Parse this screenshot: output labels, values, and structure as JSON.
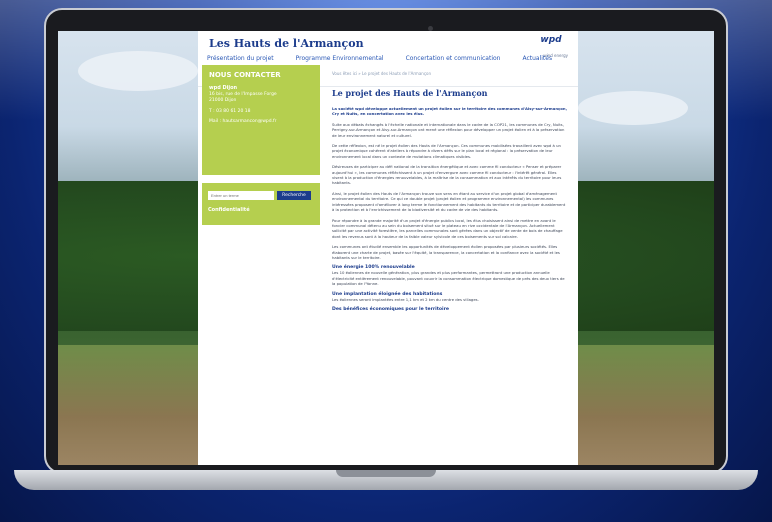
{
  "site": {
    "title": "Les Hauts de l'Armançon",
    "logo": "wpd",
    "logo_sub": "wind energy",
    "nav": [
      "Présentation du projet",
      "Programme Environnemental",
      "Concertation et communication",
      "Actualités"
    ]
  },
  "sidebar": {
    "contact_title": "NOUS CONTACTER",
    "contact_org": "wpd Dijon",
    "contact_address_1": "16 bis, rue de l'Impasse Forge",
    "contact_address_2": "21000 Dijon",
    "contact_phone": "T : 03 80 61 20 18",
    "contact_email": "Mail : hautsarmancon@wpd.fr",
    "search_placeholder": "Entrer un terme",
    "search_button": "Recherche",
    "confidentiality": "Confidentialité"
  },
  "main": {
    "breadcrumb": "Vous êtes ici » Le projet des Hauts de l'Armançon",
    "title": "Le projet des Hauts de l'Armançon",
    "intro": "La société wpd développe actuellement un projet éolien sur le territoire des communes d'Aisy-sur-Armançon, Cry et Nuits, en concertation avec les élus.",
    "paragraphs": [
      "Suite aux débats échangés à l'échelle nationale et internationale dans le cadre de la COP21, les communes de Cry, Nuits, Perrigny-sur-Armançon et Aisy-sur-Armançon ont mené une réflexion pour développer un projet éolien et à la préservation de leur environnement naturel et culturel.",
      "De cette réflexion, est né le projet éolien des Hauts de l'Armançon. Ces communes mobilisées travaillent avec wpd à un projet économique cohérent d'ateliers à répondre à divers défis sur le plan local et régional : la préservation de leur environnement local dans un contexte de mutations climatiques visibles.",
      "Désireuses de participer au défi national de la transition énergétique et avec comme fil conducteur « Penser et préparer aujourd'hui », les communes réfléchissent à un projet d'envergure avec comme fil conducteur : l'intérêt général. Elles visent à la production d'énergies renouvelables, à la maîtrise de la consommation et aux intérêts du territoire pour leurs habitants.",
      "Ainsi, le projet éolien des Hauts de l'Armançon trouve son sens en étant au service d'un projet global d'aménagement environnemental du territoire. Ce qui ce double projet (projet éolien et programme environnemental) les communes intéressées proposent d'améliorer à long terme le fonctionnement des habitants du territoire et de participer durablement à la protection et à l'enrichissement de la biodiversité et du cadre de vie des habitants.",
      "Pour répondre à la grande majorité d'un projet d'énergie publics local, les élus choisissent ainsi de mettre en avant le foncier communal détenu au sein du boisement situé sur le plateau en rive occidentale de l'Armançon. Actuellement sollicité par une activité forestière, les parcelles communales sont gérées dans un objectif de vente de bois de chauffage dont les revenus sont à la hauteur de la faible valeur sylvicole de ces boisements sur sol calcaire.",
      "Les communes ont étudié ensemble les opportunités de développement éolien proposées par plusieurs sociétés. Elles élaborent une charte de projet, basée sur l'équité, la transparence, la concertation et la confiance avec la société et les habitants sur le territoire."
    ],
    "section_1_title": "Une énergie 100% renouvelable",
    "section_1_text": "Les 10 éoliennes de nouvelle génération, plus grandes et plus performantes, permettront une production annuelle d'électricité entièrement renouvelable, pouvant couvrir la consommation électrique domestique de près des deux tiers de la population de l'Yonne.",
    "section_2_title": "Une implantation éloignée des habitations",
    "section_2_text": "Les éoliennes seront implantées entre 1,1 km et 2 km du centre des villages.",
    "section_3_title": "Des bénéfices économiques pour le territoire"
  }
}
